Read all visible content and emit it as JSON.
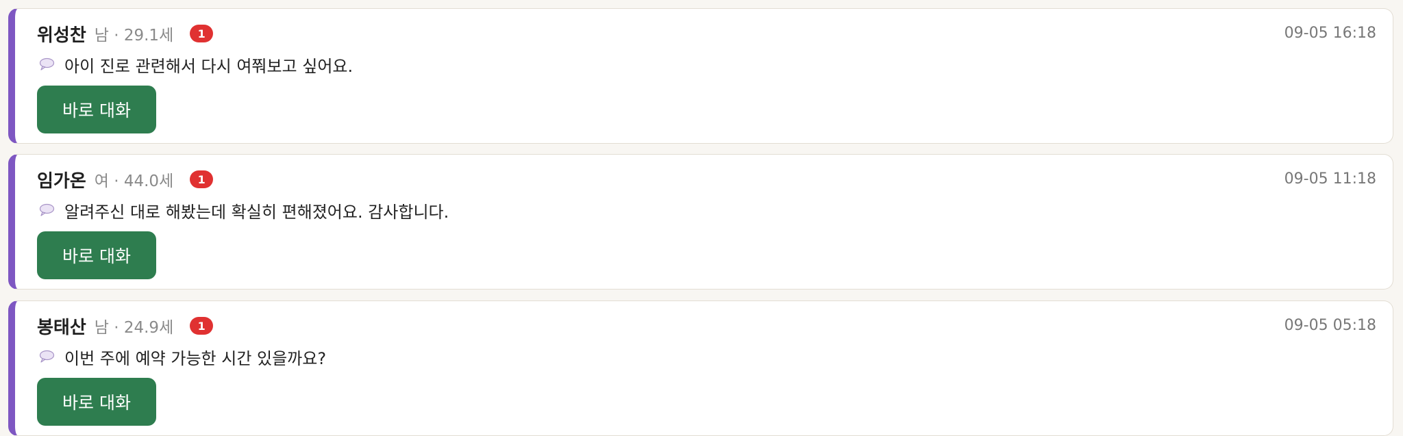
{
  "conversations": [
    {
      "name": "위성찬",
      "meta": "남 · 29.1세",
      "unread": "1",
      "time": "09-05 16:18",
      "message": "아이 진로 관련해서 다시 여쭤보고 싶어요.",
      "button_label": "바로 대화",
      "icon": "speech-bubble-icon"
    },
    {
      "name": "임가온",
      "meta": "여 · 44.0세",
      "unread": "1",
      "time": "09-05 11:18",
      "message": "알려주신 대로 해봤는데 확실히 편해졌어요. 감사합니다.",
      "button_label": "바로 대화",
      "icon": "speech-bubble-icon"
    },
    {
      "name": "봉태산",
      "meta": "남 · 24.9세",
      "unread": "1",
      "time": "09-05 05:18",
      "message": "이번 주에 예약 가능한 시간 있을까요?",
      "button_label": "바로 대화",
      "icon": "speech-bubble-icon"
    }
  ],
  "colors": {
    "accent": "#7e57c2",
    "button": "#2e7d4f",
    "badge": "#e03131",
    "background": "#f8f6f2"
  }
}
